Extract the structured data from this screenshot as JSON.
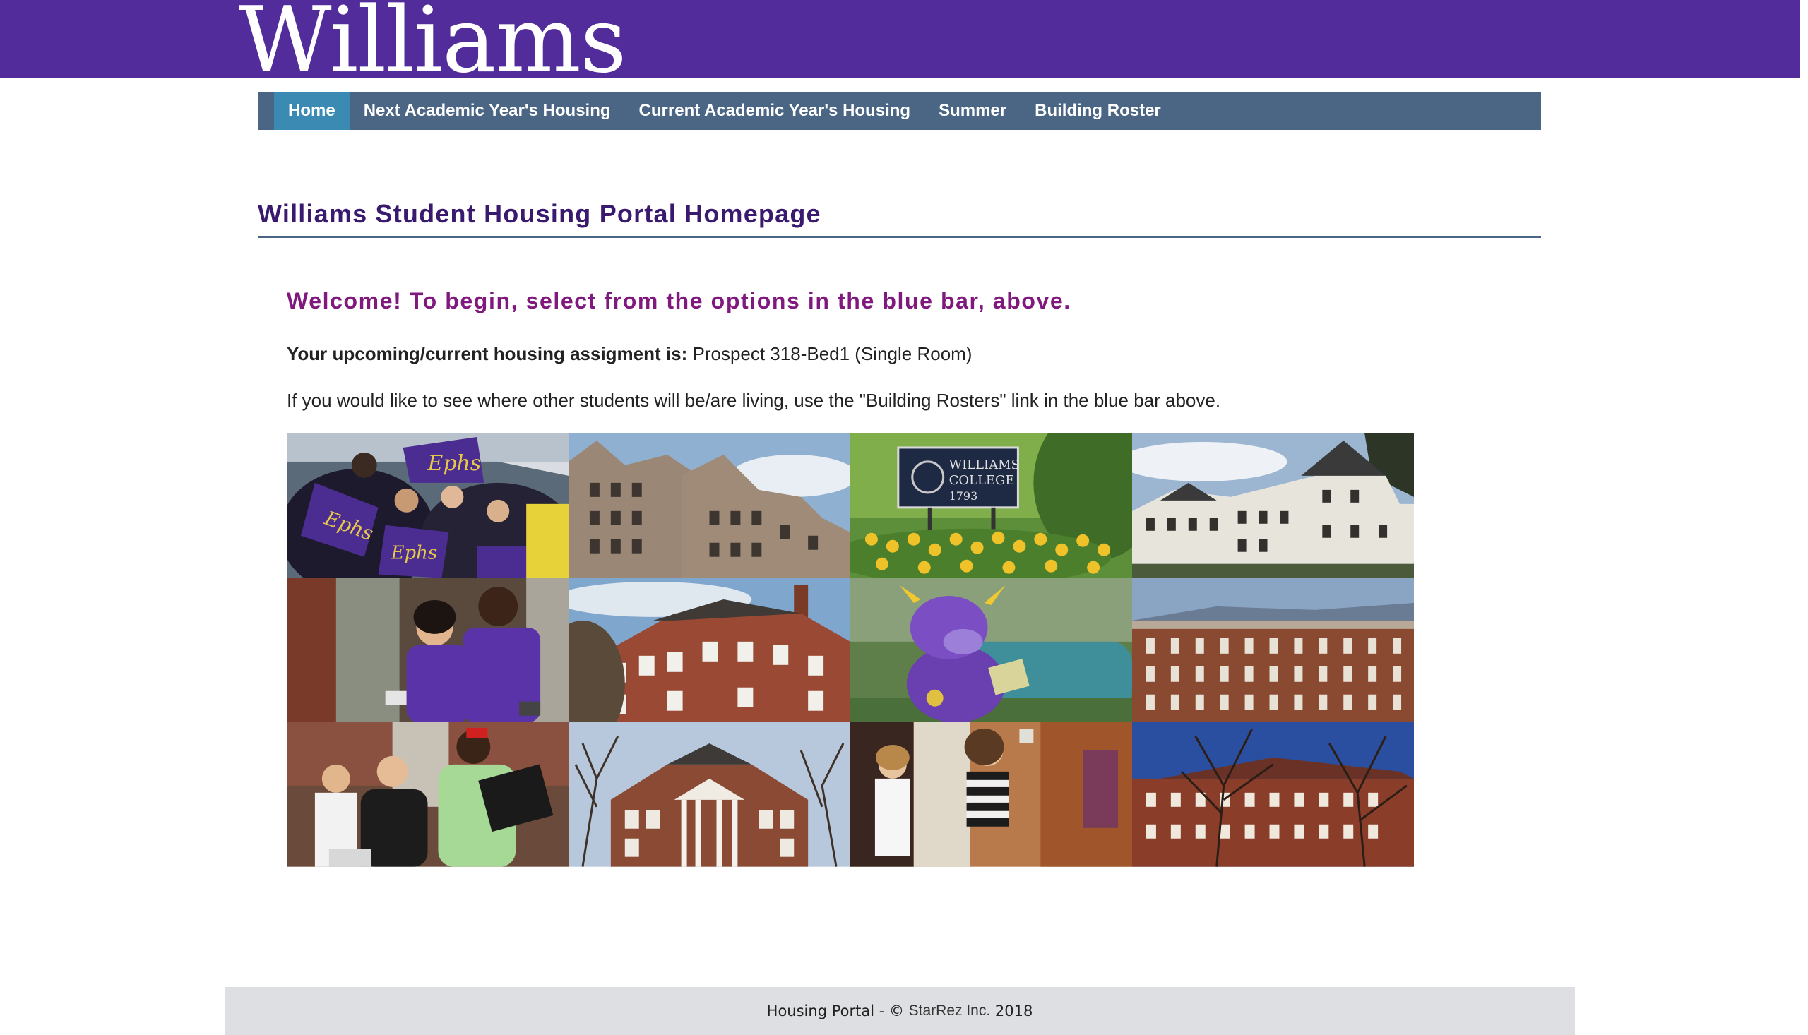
{
  "header": {
    "logo_text": "Williams",
    "brand_color": "#512c9a"
  },
  "nav": {
    "items": [
      {
        "label": "Home",
        "active": true
      },
      {
        "label": "Next Academic Year's Housing",
        "active": false
      },
      {
        "label": "Current Academic Year's Housing",
        "active": false
      },
      {
        "label": "Summer",
        "active": false
      },
      {
        "label": "Building Roster",
        "active": false
      }
    ],
    "bar_color": "#4a6684",
    "active_color": "#3b8ab4"
  },
  "main": {
    "page_title": "Williams Student Housing Portal Homepage",
    "welcome": "Welcome! To begin, select from the options in the blue bar, above.",
    "assignment_label": "Your upcoming/current housing assigment is:",
    "assignment_value": "Prospect 318-Bed1 (Single Room)",
    "info_text": "If you would like to see where other students will be/are living, use the \"Building Rosters\" link in the blue bar above.",
    "collage_tiles": [
      "students-with-ephs-banners",
      "stone-gothic-building",
      "williams-college-1793-sign",
      "white-victorian-houses",
      "students-moving-in",
      "brick-colonial-house",
      "purple-cow-mascot-reading",
      "brick-dormitory",
      "students-carrying-boxes",
      "brick-house-with-columns",
      "students-in-dorm-room",
      "brick-hall-with-trees"
    ],
    "sign_text": [
      "WILLIAMS",
      "COLLEGE",
      "1793"
    ],
    "banner_text": "Ephs"
  },
  "footer": {
    "prefix": "Housing Portal - © ",
    "brand": "StarRez Inc.",
    "year": " 2018"
  }
}
